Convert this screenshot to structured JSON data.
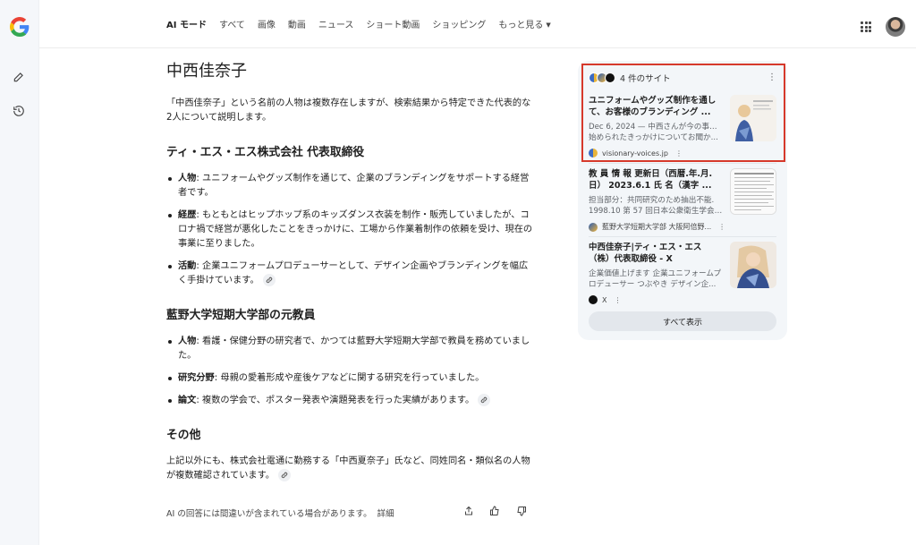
{
  "nav": {
    "tabs": [
      {
        "label": "AI モード",
        "active": true
      },
      {
        "label": "すべて"
      },
      {
        "label": "画像"
      },
      {
        "label": "動画"
      },
      {
        "label": "ニュース"
      },
      {
        "label": "ショート動画"
      },
      {
        "label": "ショッピング"
      },
      {
        "label": "もっと見る"
      }
    ]
  },
  "icons": {
    "logo": "google-g-logo",
    "new_chat": "new-chat-icon",
    "history": "history-icon",
    "apps": "apps-grid-icon",
    "link": "link-icon",
    "share": "share-icon",
    "thumbs_up": "thumbs-up-icon",
    "thumbs_down": "thumbs-down-icon"
  },
  "answer": {
    "title": "中西佳奈子",
    "intro": "「中西佳奈子」という名前の人物は複数存在しますが、検索結果から特定できた代表的な2人について説明します。",
    "sections": [
      {
        "heading": "ティ・エス・エス株式会社 代表取締役",
        "items": [
          {
            "label": "人物",
            "text": ": ユニフォームやグッズ制作を通じて、企業のブランディングをサポートする経営者です。"
          },
          {
            "label": "経歴",
            "text": ": もともとはヒップホップ系のキッズダンス衣装を制作・販売していましたが、コロナ禍で経営が悪化したことをきっかけに、工場から作業着制作の依頼を受け、現在の事業に至りました。"
          },
          {
            "label": "活動",
            "text": ": 企業ユニフォームプロデューサーとして、デザイン企画やブランディングを幅広く手掛けています。"
          }
        ]
      },
      {
        "heading": "藍野大学短期大学部の元教員",
        "items": [
          {
            "label": "人物",
            "text": ": 看護・保健分野の研究者で、かつては藍野大学短期大学部で教員を務めていました。"
          },
          {
            "label": "研究分野",
            "text": ": 母親の愛着形成や産後ケアなどに関する研究を行っていました。"
          },
          {
            "label": "論文",
            "text": ": 複数の学会で、ポスター発表や演題発表を行った実績があります。"
          }
        ]
      },
      {
        "heading": "その他",
        "paragraph": "上記以外にも、株式会社電通に勤務する「中西夏奈子」氏など、同姓同名・類似名の人物が複数確認されています。"
      }
    ],
    "disclaimer": "AI の回答には間違いが含まれている場合があります。",
    "disclaimer_more": "詳細"
  },
  "sources": {
    "header": "4 件のサイト",
    "cards": [
      {
        "title": "ユニフォームやグッズ制作を通して、お客様のブランディング ...",
        "snippet_1": "Dec 6, 2024 — 中西さんが今の事業を",
        "snippet_2": "始められたきっかけについてお聞か...",
        "source": "visionary-voices.jp"
      },
      {
        "title": "教 員 情 報 更新日（西暦.年.月.日） 2023.6.1 氏 名（漢字 ...",
        "snippet_1": "担当部分：共同研究のため抽出不能.",
        "snippet_2": "1998.10 第 57 回日本公衆衛生学会,...",
        "source": "藍野大学短期大学部 大阪阿倍野..."
      },
      {
        "title": "中西佳奈子|ティ・エス・エス（株）代表取締役 - X",
        "snippet_1": "企業価値上げます 企業ユニフォームプ",
        "snippet_2": "ロデューサー つぶやき デザイン企...",
        "source": "X"
      }
    ],
    "show_all": "すべて表示"
  },
  "colors": {
    "highlight": "#d6392b",
    "panel_bg": "#f3f6f9",
    "rail_bg": "#f5f7fa"
  }
}
